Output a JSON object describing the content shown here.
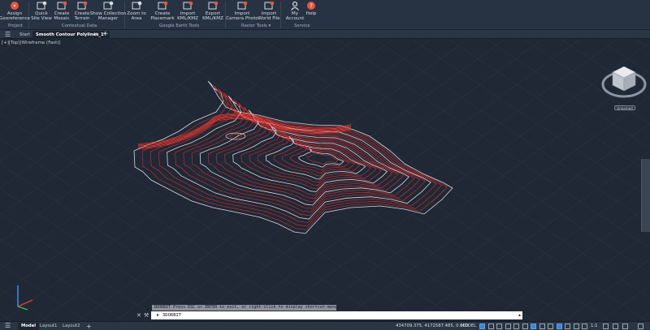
{
  "ribbon": {
    "buttons": [
      {
        "id": "assign-georeference",
        "label": "Assign\nGeoreference",
        "icon": "geo-pin-icon"
      },
      {
        "id": "quick-site-view",
        "label": "Quick\nSite View",
        "icon": "globe-icon"
      },
      {
        "id": "create-mosaic",
        "label": "Create\nMosaic",
        "icon": "mosaic-icon"
      },
      {
        "id": "create-terrain",
        "label": "Create\nTerrain",
        "icon": "terrain-icon"
      },
      {
        "id": "show-collection-manager",
        "label": "Show Collection\nManager",
        "icon": "collection-icon"
      },
      {
        "id": "zoom-to-area",
        "label": "Zoom to\nArea",
        "icon": "zoom-area-icon"
      },
      {
        "id": "create-placemark",
        "label": "Create\nPlacemark",
        "icon": "placemark-icon"
      },
      {
        "id": "import-kml",
        "label": "Import\nKML/KMZ",
        "icon": "import-kml-icon"
      },
      {
        "id": "export-kml",
        "label": "Export\nKML/KMZ",
        "icon": "export-kml-icon"
      },
      {
        "id": "import-camera-photo",
        "label": "Import\nCamera Photo",
        "icon": "camera-icon"
      },
      {
        "id": "import-world-file",
        "label": "Import\nWorld File",
        "icon": "world-file-icon"
      },
      {
        "id": "my-account",
        "label": "My\nAccount",
        "icon": "account-icon"
      },
      {
        "id": "help",
        "label": "Help",
        "icon": "help-icon"
      }
    ],
    "panels": {
      "project": "Project",
      "contextual": "Contextual Data",
      "google": "Google Earth Tools",
      "raster": "Raster Tools",
      "service": "Service"
    }
  },
  "tabs": {
    "start": "Start",
    "drawing": "Smooth Contour Polylines_1*"
  },
  "viewport": {
    "label": "[+][Top][Wireframe (Fast)]",
    "viewcube_label": "Unnamed",
    "contour_color": "#e0312e",
    "index_color": "#d8d8d8"
  },
  "command": {
    "history": "3DORBIT Press ESC or ENTER to exit, or right-click to display shortcut-menu.",
    "prompt": "3DORBIT"
  },
  "status": {
    "layouts": [
      "Model",
      "Layout1",
      "Layout2"
    ],
    "coordinates": "434709.375, 4172587.485, 0.000",
    "space": "MODEL",
    "scale": "1:1"
  }
}
